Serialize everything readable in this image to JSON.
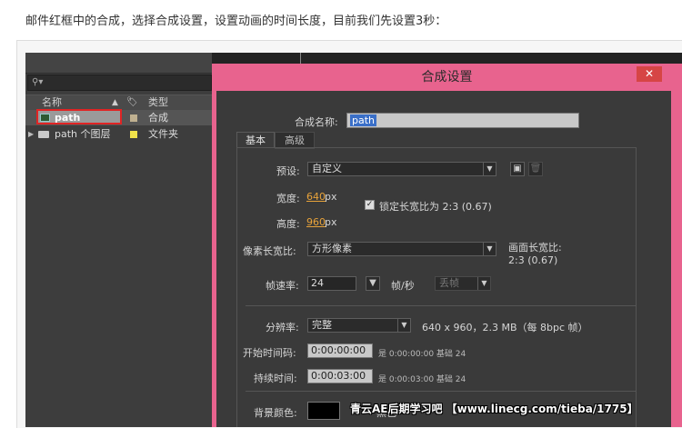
{
  "caption": "邮件红框中的合成，选择合成设置，设置动画的时间长度，目前我们先设置3秒：",
  "project_panel": {
    "search_icon": "search-icon",
    "columns": {
      "name": "名称",
      "sort": "▲",
      "tag": "🏷",
      "type": "类型"
    },
    "items": [
      {
        "name": "path",
        "type": "合成",
        "swatch": "#bfb090",
        "icon": "composition-icon"
      },
      {
        "name": "path 个图层",
        "type": "文件夹",
        "swatch": "#f0e24a",
        "icon": "folder-icon"
      }
    ]
  },
  "dialog": {
    "title": "合成设置",
    "close": "✕",
    "name_label": "合成名称:",
    "name_value": "path",
    "tabs": [
      "基本",
      "高级"
    ],
    "preset_label": "预设:",
    "preset_value": "自定义",
    "width_label": "宽度:",
    "width_value": "640",
    "height_label": "高度:",
    "height_value": "960",
    "px": "px",
    "lock_label": "锁定长宽比为 2:3 (0.67)",
    "par_label": "像素长宽比:",
    "par_value": "方形像素",
    "frame_aspect_label": "画面长宽比:",
    "frame_aspect_value": "2:3 (0.67)",
    "fps_label": "帧速率:",
    "fps_value": "24",
    "fps_unit": "帧/秒",
    "drop_frame": "丢帧",
    "resolution_label": "分辨率:",
    "resolution_value": "完整",
    "resolution_info": "640 x 960，2.3 MB（每 8bpc 帧）",
    "start_label": "开始时间码:",
    "start_value": "0:00:00:00",
    "start_info": "是 0:00:00:00  基础 24",
    "duration_label": "持续时间:",
    "duration_value": "0:00:03:00",
    "duration_info": "是 0:00:03:00  基础 24",
    "bg_label": "背景颜色:",
    "bg_color_name": "黑色",
    "bg_color": "#000000"
  },
  "watermark": "青云AE后期学习吧 【www.linecg.com/tieba/1775】"
}
